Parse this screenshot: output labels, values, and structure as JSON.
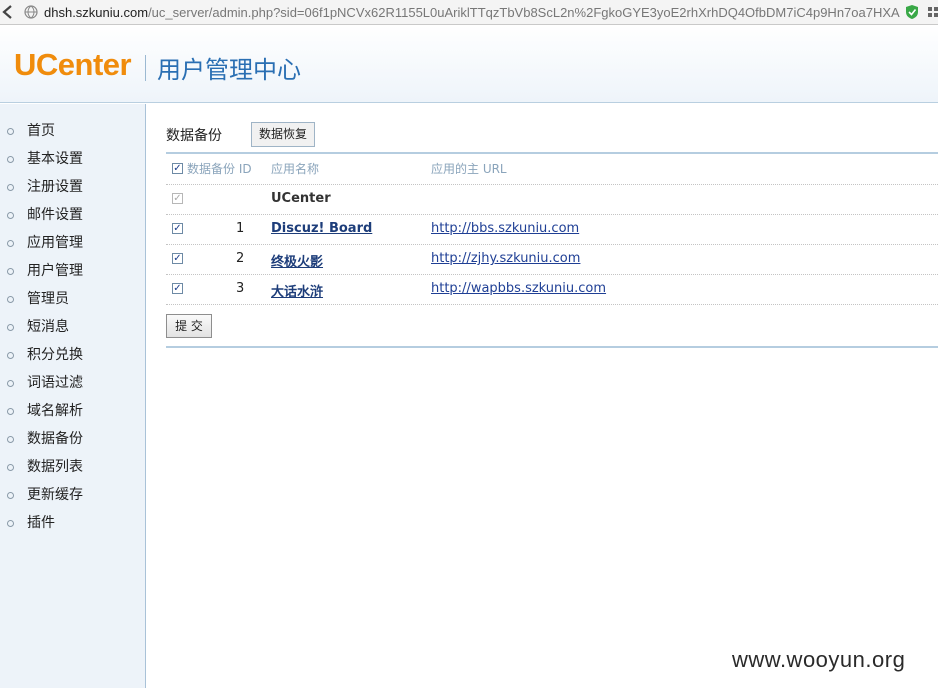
{
  "browser": {
    "url_host": "dhsh.szkuniu.com",
    "url_path": "/uc_server/admin.php?sid=06f1pNCVx62R1155L0uAriklTTqzTbVb8ScL2n%2FgkoGYE3yoE2rhXrhDQ4OfbDM7iC4p9Hn7oa7HXA"
  },
  "header": {
    "logo": "UCenter",
    "title": "用户管理中心"
  },
  "sidebar": {
    "items": [
      {
        "label": "首页"
      },
      {
        "label": "基本设置"
      },
      {
        "label": "注册设置"
      },
      {
        "label": "邮件设置"
      },
      {
        "label": "应用管理"
      },
      {
        "label": "用户管理"
      },
      {
        "label": "管理员"
      },
      {
        "label": "短消息"
      },
      {
        "label": "积分兑换"
      },
      {
        "label": "词语过滤"
      },
      {
        "label": "域名解析"
      },
      {
        "label": "数据备份"
      },
      {
        "label": "数据列表"
      },
      {
        "label": "更新缓存"
      },
      {
        "label": "插件"
      }
    ]
  },
  "main": {
    "section_title": "数据备份",
    "restore_button": "数据恢复",
    "table": {
      "headers": {
        "col1": "数据备份 ID",
        "col2": "应用名称",
        "col3": "应用的主 URL"
      },
      "rows": [
        {
          "checked": true,
          "disabled": true,
          "id": "",
          "name": "UCenter",
          "url": ""
        },
        {
          "checked": true,
          "disabled": false,
          "id": "1",
          "name": "Discuz! Board",
          "url": "http://bbs.szkuniu.com"
        },
        {
          "checked": true,
          "disabled": false,
          "id": "2",
          "name": "终极火影",
          "url": "http://zjhy.szkuniu.com"
        },
        {
          "checked": true,
          "disabled": false,
          "id": "3",
          "name": "大话水浒",
          "url": "http://wapbbs.szkuniu.com"
        }
      ]
    },
    "submit_button": "提 交"
  },
  "watermark": "www.wooyun.org",
  "colors": {
    "logo": "#f08c0c",
    "title": "#2a6fb3",
    "sidebar_bg": "#edf3f9",
    "link": "#1f3f95"
  }
}
